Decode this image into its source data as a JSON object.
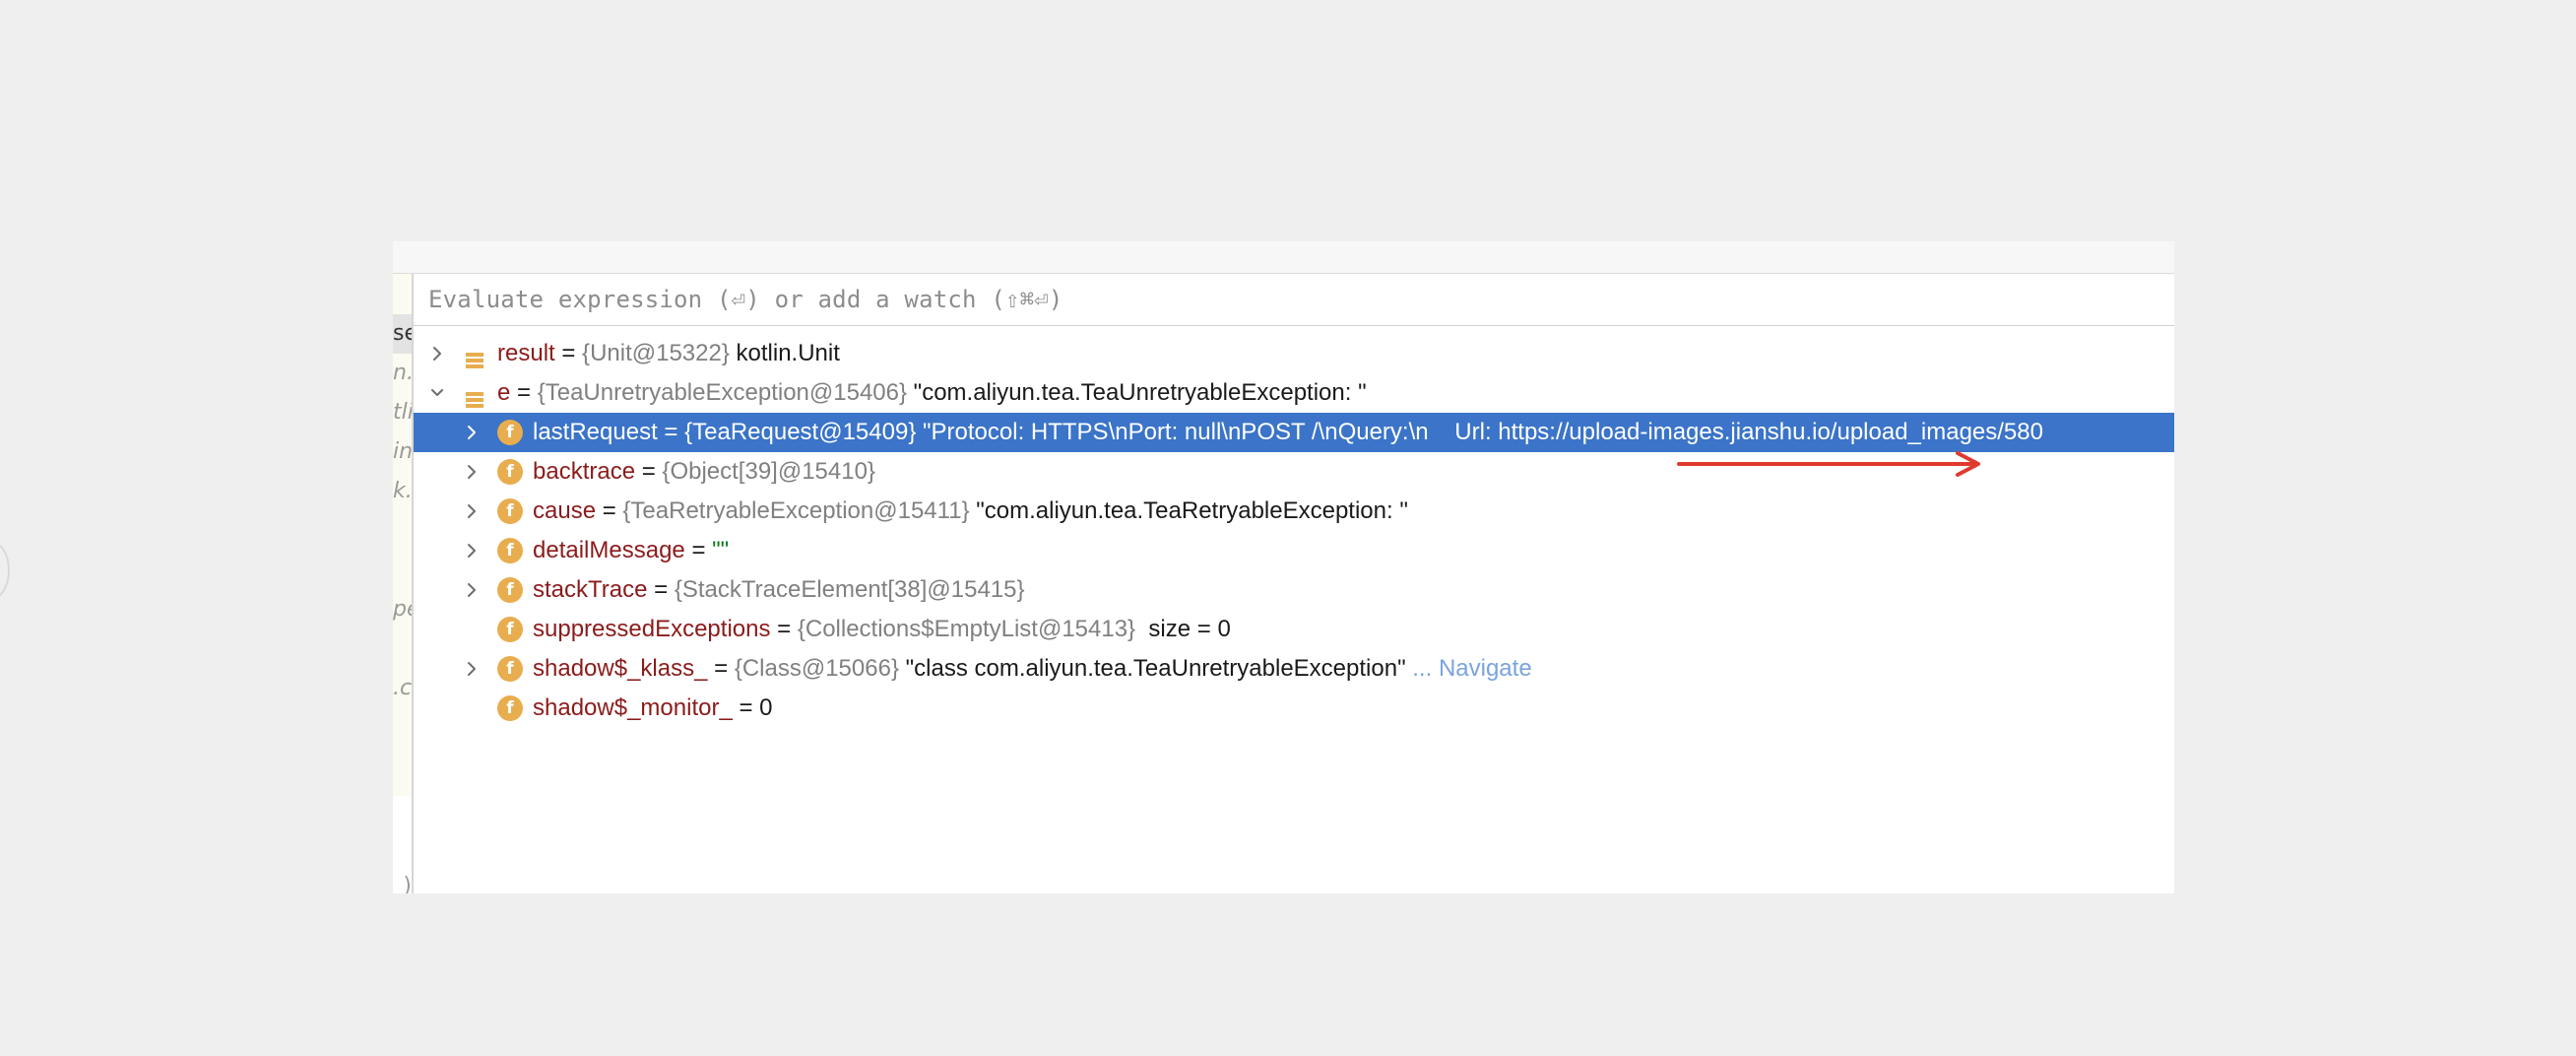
{
  "watch": {
    "placeholder": "Evaluate expression (⏎) or add a watch (⇧⌘⏎)"
  },
  "gutter_fragments": [
    {
      "text": "se",
      "selected": true
    },
    {
      "text": "n.",
      "selected": false
    },
    {
      "text": "tli",
      "selected": false
    },
    {
      "text": "in",
      "selected": false
    },
    {
      "text": "k.c",
      "selected": false
    },
    {
      "text": "",
      "selected": false
    },
    {
      "text": "",
      "selected": false
    },
    {
      "text": "pe",
      "selected": false
    },
    {
      "text": "",
      "selected": false
    },
    {
      "text": ".c",
      "selected": false
    }
  ],
  "gutter_bottom_text": ")",
  "variables": [
    {
      "name": "result",
      "type": "{Unit@15322}",
      "value": "kotlin.Unit",
      "icon": "list-icon",
      "expandable": true,
      "expanded": false
    },
    {
      "name": "e",
      "type": "{TeaUnretryableException@15406}",
      "value": "\"com.aliyun.tea.TeaUnretryableException: \"",
      "icon": "list-icon",
      "expandable": true,
      "expanded": true
    }
  ],
  "fields": [
    {
      "name": "lastRequest",
      "type": "{TeaRequest@15409}",
      "value": "\"Protocol: HTTPS\\nPort: null\\nPOST /\\nQuery:\\n    Url: https://upload-images.jianshu.io/upload_images/580",
      "expandable": true,
      "selected": true
    },
    {
      "name": "backtrace",
      "type": "{Object[39]@15410}",
      "value": "",
      "expandable": true,
      "selected": false
    },
    {
      "name": "cause",
      "type": "{TeaRetryableException@15411}",
      "value": "\"com.aliyun.tea.TeaRetryableException: \"",
      "expandable": true,
      "selected": false
    },
    {
      "name": "detailMessage",
      "type": "",
      "value": "\"\"",
      "value_color": "#067d17",
      "expandable": true,
      "selected": false
    },
    {
      "name": "stackTrace",
      "type": "{StackTraceElement[38]@15415}",
      "value": "",
      "expandable": true,
      "selected": false
    },
    {
      "name": "suppressedExceptions",
      "type": "{Collections$EmptyList@15413}",
      "value": " size = 0",
      "expandable": false,
      "selected": false
    },
    {
      "name": "shadow$_klass_",
      "type": "{Class@15066}",
      "value": "\"class com.aliyun.tea.TeaUnretryableException\"",
      "link": "... Navigate",
      "expandable": true,
      "selected": false
    },
    {
      "name": "shadow$_monitor_",
      "type": "",
      "value": "0",
      "expandable": false,
      "selected": false
    }
  ],
  "field_icon_letter": "f",
  "equals": "=",
  "colors": {
    "selection": "#3b74c8",
    "field_name": "#8b1b1b",
    "field_icon": "#e8ad4e",
    "annotation_arrow": "#e03a2e",
    "navigate_link": "#7aa3de"
  }
}
